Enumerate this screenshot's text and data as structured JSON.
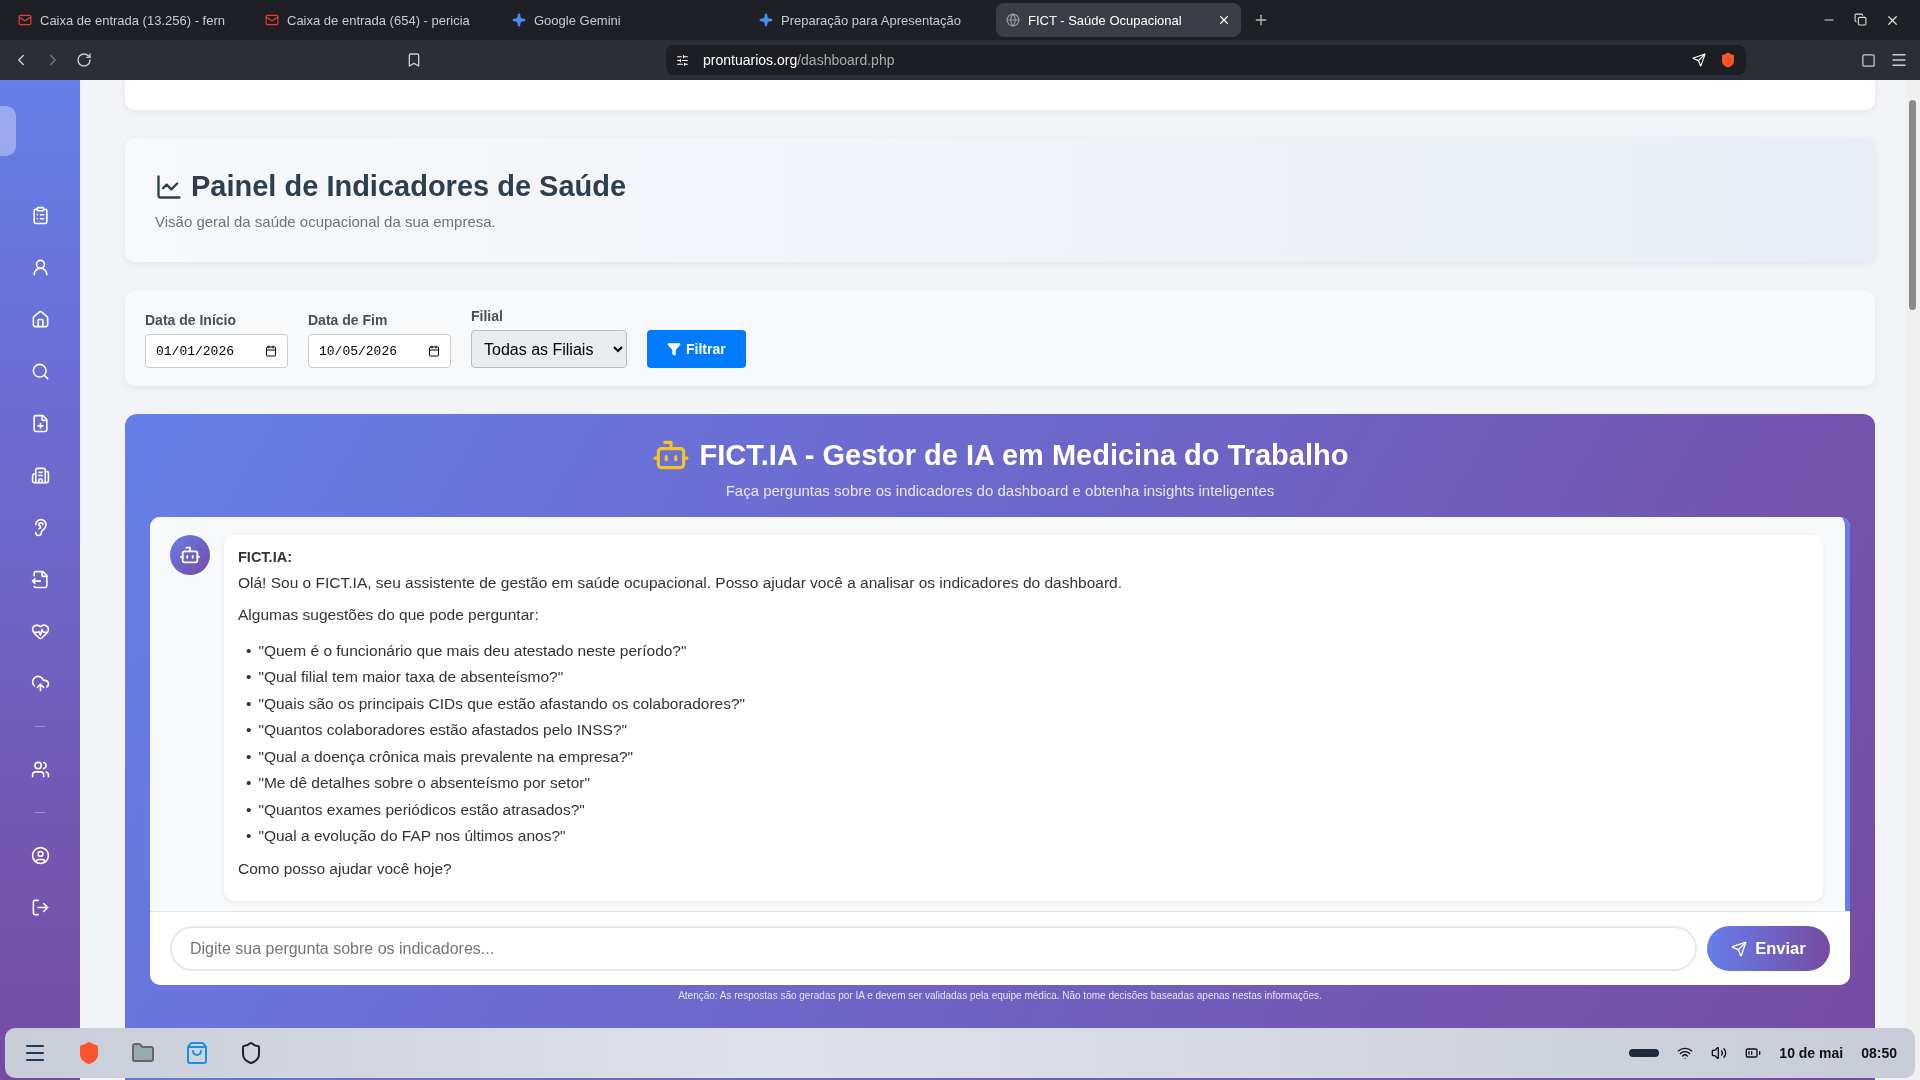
{
  "browser": {
    "tabs": [
      {
        "title": "Caixa de entrada (13.256) - fern",
        "kind": "mail",
        "selected": false
      },
      {
        "title": "Caixa de entrada (654) - pericia",
        "kind": "mail",
        "selected": false
      },
      {
        "title": "Google Gemini",
        "kind": "spark",
        "selected": false
      },
      {
        "title": "Preparação para Apresentação",
        "kind": "spark",
        "selected": false
      },
      {
        "title": "FICT - Saúde Ocupacional",
        "kind": "site",
        "selected": true
      }
    ],
    "url": {
      "domain": "prontuarios.org",
      "path": "/dashboard.php"
    }
  },
  "header": {
    "title": "Painel de Indicadores de Saúde",
    "subtitle": "Visão geral da saúde ocupacional da sua empresa."
  },
  "filters": {
    "fields": [
      {
        "label": "Data de Início",
        "value": "01/01/2026"
      },
      {
        "label": "Data de Fim",
        "value": "10/05/2026"
      }
    ],
    "branch": {
      "label": "Filial",
      "value": "Todas as Filiais"
    },
    "button": "Filtrar"
  },
  "assistant": {
    "title": "FICT.IA - Gestor de IA em Medicina do Trabalho",
    "subtitle": "Faça perguntas sobre os indicadores do dashboard e obtenha insights inteligentes",
    "messages": [
      {
        "sender": "FICT.IA:",
        "greeting": "Olá! Sou o FICT.IA, seu assistente de gestão em saúde ocupacional. Posso ajudar você a analisar os indicadores do dashboard.",
        "intro": "Algumas sugestões do que pode perguntar:",
        "bullet": "•",
        "suggestions": [
          "\"Quem é o funcionário que mais deu atestado neste período?\"",
          "\"Qual filial tem maior taxa de absenteísmo?\"",
          "\"Quais são os principais CIDs que estão afastando os colaboradores?\"",
          "\"Quantos colaboradores estão afastados pelo INSS?\"",
          "\"Qual a doença crônica mais prevalente na empresa?\"",
          "\"Me dê detalhes sobre o absenteísmo por setor\"",
          "\"Quantos exames periódicos estão atrasados?\"",
          "\"Qual a evolução do FAP nos últimos anos?\""
        ],
        "closing": "Como posso ajudar você hoje?"
      }
    ],
    "input": {
      "placeholder": "Digite sua pergunta sobre os indicadores..."
    },
    "send": "Enviar",
    "disclaimer": "Atenção: As respostas são geradas por IA e devem ser validadas pela equipe médica. Não tome decisões baseadas apenas nestas informações."
  },
  "taskbar": {
    "date": "10 de mai",
    "time": "08:50"
  }
}
